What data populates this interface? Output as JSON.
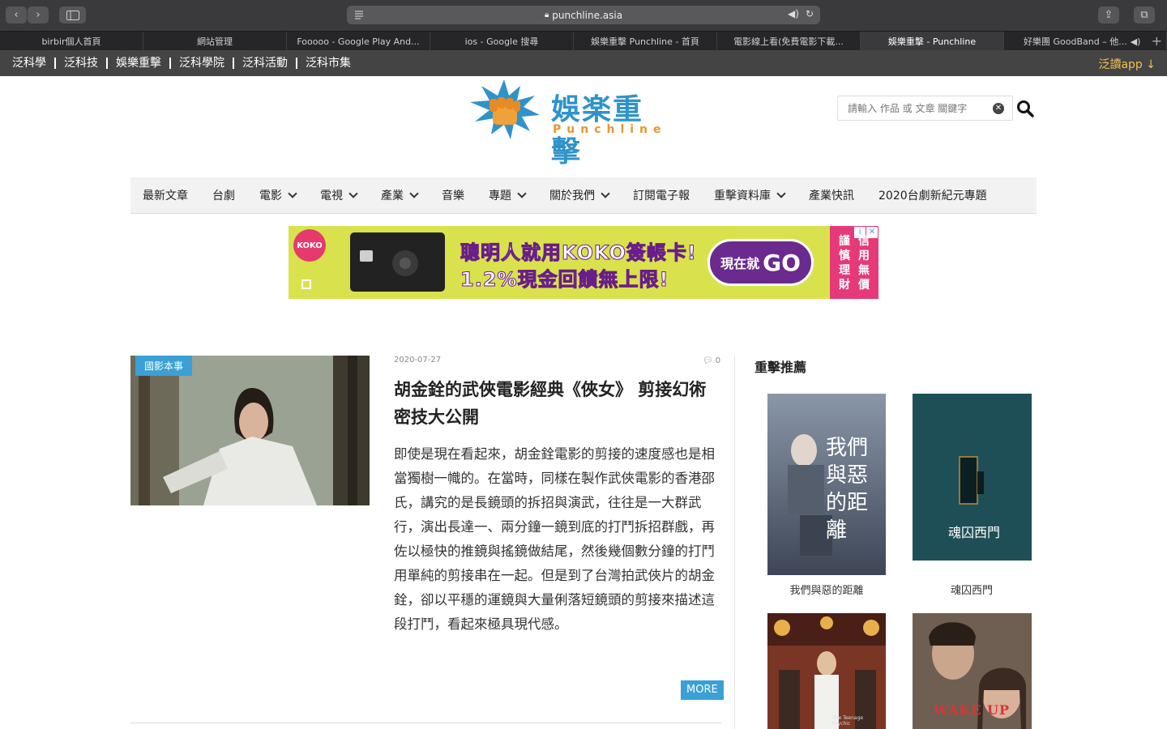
{
  "browser": {
    "url": "punchline.asia",
    "tabs": [
      {
        "label": "birbir個人首頁"
      },
      {
        "label": "網站管理"
      },
      {
        "label": "Fooooo - Google Play And..."
      },
      {
        "label": "ios - Google 搜尋"
      },
      {
        "label": "娛樂重擊 Punchline - 首頁"
      },
      {
        "label": "電影線上看(免費電影下載..."
      },
      {
        "label": "娛樂重擊 - Punchline"
      },
      {
        "label": "好樂團 GoodBand – 他..."
      }
    ],
    "active_tab": 6
  },
  "sitebar": {
    "links": [
      "泛科學",
      "泛科技",
      "娛樂重擊",
      "泛科學院",
      "泛科活動",
      "泛科市集"
    ],
    "app_label": "泛讀app"
  },
  "logo": {
    "cn": "娛楽重擊",
    "en": "Punchline"
  },
  "search": {
    "placeholder": "請輸入 作品 或 文章 關鍵字"
  },
  "nav": {
    "items": [
      {
        "label": "最新文章",
        "dropdown": false
      },
      {
        "label": "台劇",
        "dropdown": false
      },
      {
        "label": "電影",
        "dropdown": true
      },
      {
        "label": "電視",
        "dropdown": true
      },
      {
        "label": "產業",
        "dropdown": true
      },
      {
        "label": "音樂",
        "dropdown": false
      },
      {
        "label": "專題",
        "dropdown": true
      },
      {
        "label": "關於我們",
        "dropdown": true
      },
      {
        "label": "訂閱電子報",
        "dropdown": false
      },
      {
        "label": "重擊資料庫",
        "dropdown": true
      },
      {
        "label": "產業快訊",
        "dropdown": false
      },
      {
        "label": "2020台劇新紀元專題",
        "dropdown": false
      }
    ]
  },
  "ad": {
    "brand": "KOKO",
    "line1": "聰明人就用KOKO簽帳卡!",
    "line2": "1.2%現金回饋無上限!",
    "cta_small": "現在就",
    "cta_big": "GO",
    "warning": [
      "謹",
      "信",
      "慎",
      "用",
      "理",
      "無",
      "財",
      "價"
    ]
  },
  "article": {
    "category": "國影本事",
    "date": "2020-07-27",
    "comments": "0",
    "title": "胡金銓的武俠電影經典《俠女》 剪接幻術密技大公開",
    "excerpt": "即使是現在看起來，胡金銓電影的剪接的速度感也是相當獨樹一幟的。在當時，同樣在製作武俠電影的香港邵氏，講究的是長鏡頭的拆招與演武，往往是一大群武行，演出長達一、兩分鐘一鏡到底的打鬥拆招群戲，再佐以極快的推鏡與搖鏡做結尾，然後幾個數分鐘的打鬥用單純的剪接串在一起。但是到了台灣拍武俠片的胡金銓，卻以平穩的運鏡與大量俐落短鏡頭的剪接來描述這段打鬥，看起來極具現代感。",
    "more": "MORE"
  },
  "sidebar": {
    "heading": "重擊推薦",
    "posters": [
      {
        "caption": "我們與惡的距離",
        "poster_text": "我們與惡的距離"
      },
      {
        "caption": "魂囚西門",
        "poster_text": "魂囚西門"
      },
      {
        "caption": "",
        "poster_text": "The Teenage Psychic"
      },
      {
        "caption": "",
        "poster_text": "WAKE UP"
      }
    ]
  },
  "colors": {
    "accent": "#3aa0d5",
    "sitebar": "#444444",
    "app": "#f2c14e"
  }
}
